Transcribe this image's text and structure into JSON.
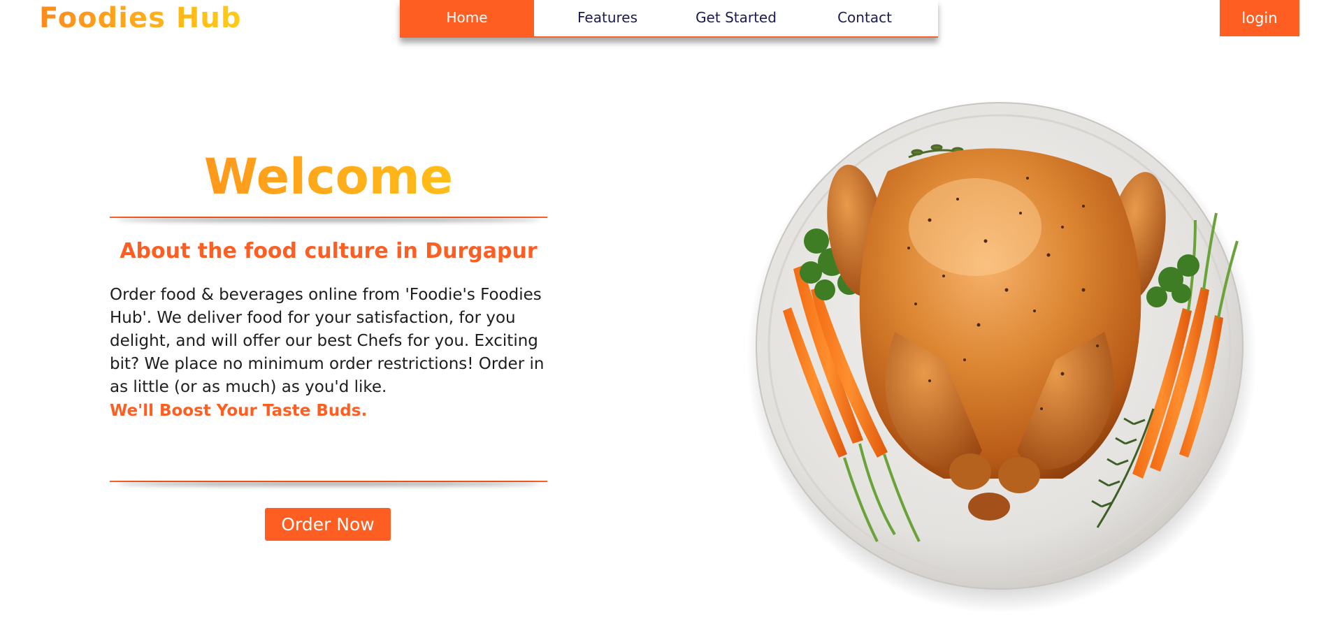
{
  "header": {
    "logo": "Foodies Hub",
    "nav": [
      {
        "label": "Home",
        "active": true
      },
      {
        "label": "Features",
        "active": false
      },
      {
        "label": "Get Started",
        "active": false
      },
      {
        "label": "Contact",
        "active": false
      }
    ],
    "login_label": "login"
  },
  "hero": {
    "title": "Welcome",
    "subtitle": "About the food culture in Durgapur",
    "description": "Order food & beverages online from 'Foodie's Foodies Hub'. We deliver food for your satisfaction, for you delight, and will offer our best Chefs for you. Exciting bit? We place no minimum order restrictions! Order in as little (or as much) as you'd like.",
    "tagline": "We'll Boost Your Taste Buds.",
    "order_label": "Order Now"
  },
  "colors": {
    "accent": "#ff5e23",
    "logo_gradient_start": "#ff8a1e",
    "logo_gradient_end": "#ffcc16",
    "nav_text": "#1c1a52"
  }
}
